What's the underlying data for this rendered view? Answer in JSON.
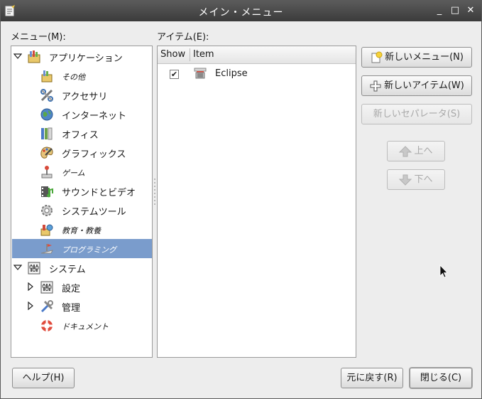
{
  "window": {
    "title": "メイン・メニュー",
    "controls": {
      "minimize": "_",
      "maximize": "□",
      "close": "✕"
    }
  },
  "menus_label": "メニュー(M):",
  "items_label": "アイテム(E):",
  "tree": [
    {
      "label": "アプリケーション",
      "icon": "applications-icon",
      "expanded": true,
      "level": 0
    },
    {
      "label": "その他",
      "icon": "other-icon",
      "level": 1,
      "small": true
    },
    {
      "label": "アクセサリ",
      "icon": "accessories-icon",
      "level": 1
    },
    {
      "label": "インターネット",
      "icon": "internet-globe-icon",
      "level": 1
    },
    {
      "label": "オフィス",
      "icon": "office-icon",
      "level": 1
    },
    {
      "label": "グラフィックス",
      "icon": "graphics-palette-icon",
      "level": 1
    },
    {
      "label": "ゲーム",
      "icon": "games-joystick-icon",
      "level": 1,
      "small": true
    },
    {
      "label": "サウンドとビデオ",
      "icon": "sound-video-icon",
      "level": 1
    },
    {
      "label": "システムツール",
      "icon": "system-tools-gear-icon",
      "level": 1
    },
    {
      "label": "教育・教養",
      "icon": "education-icon",
      "level": 1,
      "small": true
    },
    {
      "label": "プログラミング",
      "icon": "programming-icon",
      "level": 1,
      "small": true,
      "selected": true
    },
    {
      "label": "システム",
      "icon": "system-icon",
      "expanded": true,
      "level": 0
    },
    {
      "label": "設定",
      "icon": "preferences-icon",
      "level": 1,
      "collapsed": true
    },
    {
      "label": "管理",
      "icon": "administration-tools-icon",
      "level": 1,
      "collapsed": true
    },
    {
      "label": "ドキュメント",
      "icon": "documentation-lifebuoy-icon",
      "level": 1,
      "small": true
    }
  ],
  "items_table": {
    "columns": [
      "Show",
      "Item"
    ],
    "rows": [
      {
        "show": true,
        "check_glyph": "✔",
        "name": "Eclipse",
        "icon": "eclipse-icon"
      }
    ]
  },
  "buttons": {
    "new_menu": "新しいメニュー(N)",
    "new_item": "新しいアイテム(W)",
    "new_separator": "新しいセパレータ(S)",
    "move_up": "上へ",
    "move_down": "下へ",
    "help": "ヘルプ(H)",
    "revert": "元に戻す(R)",
    "close": "閉じる(C)"
  },
  "colors": {
    "selection": "#7a9ccc",
    "titlebar": "#4a4a4a"
  }
}
